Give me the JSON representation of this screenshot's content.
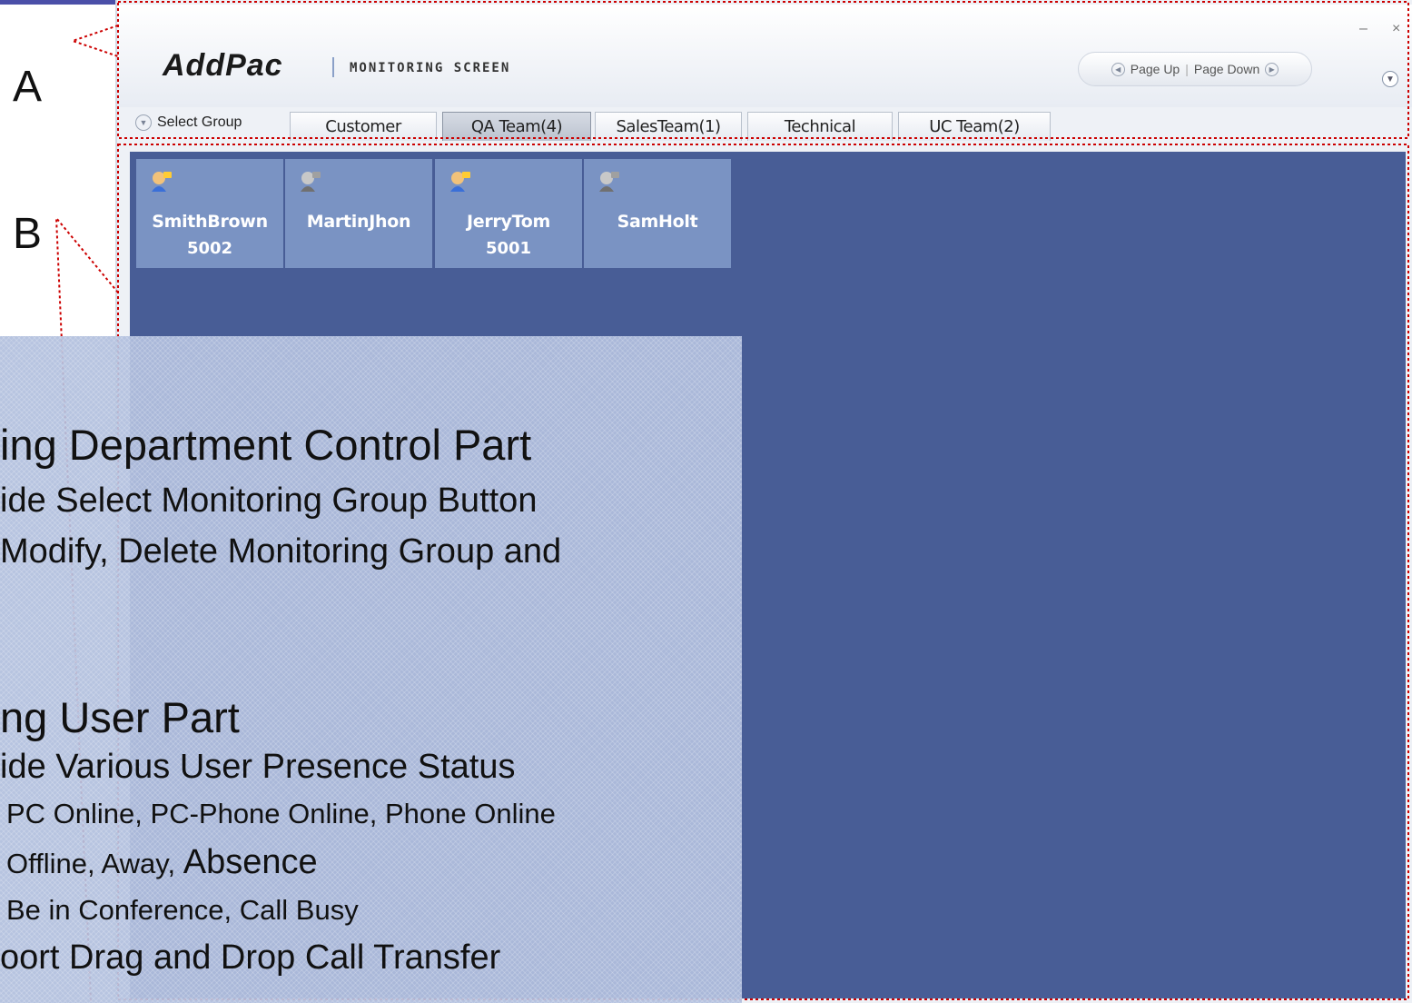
{
  "header": {
    "logo": "AddPac",
    "subtitle": "MONITORING SCREEN",
    "page_up": "Page Up",
    "page_down": "Page Down",
    "nav_separator": "|",
    "minimize": "–",
    "close": "×"
  },
  "group_bar": {
    "select_label": "Select Group",
    "tabs": [
      {
        "label": "Customer"
      },
      {
        "label": "QA Team(4)"
      },
      {
        "label": "SalesTeam(1)"
      },
      {
        "label": "Technical"
      },
      {
        "label": "UC Team(2)"
      }
    ],
    "active_tab": "QA Team(4)"
  },
  "users": [
    {
      "name": "SmithBrown",
      "ext": "5002",
      "presence": "online-icon"
    },
    {
      "name": "MartinJhon",
      "ext": "",
      "presence": "offline-icon"
    },
    {
      "name": "JerryTom",
      "ext": "5001",
      "presence": "online-icon"
    },
    {
      "name": "SamHolt",
      "ext": "",
      "presence": "offline-icon"
    }
  ],
  "callouts": {
    "a": "A",
    "b": "B"
  },
  "overlay": {
    "line1": "ing Department Control Part",
    "line2": "ide Select Monitoring Group Button",
    "line3": " Modify, Delete Monitoring Group and",
    "line4": "ng User Part",
    "line5": "ide Various User Presence Status",
    "line6": "PC Online, PC-Phone Online, Phone Online",
    "line7a": "Offline, Away, ",
    "line7b": "Absence",
    "line8": "Be in Conference, Call Busy",
    "line9": "oort Drag and Drop Call Transfer"
  },
  "colors": {
    "panel_bg": "#485d96",
    "tile_bg": "#7a93c3",
    "callout_border": "#cc0000",
    "accent": "#4b4fa8"
  }
}
